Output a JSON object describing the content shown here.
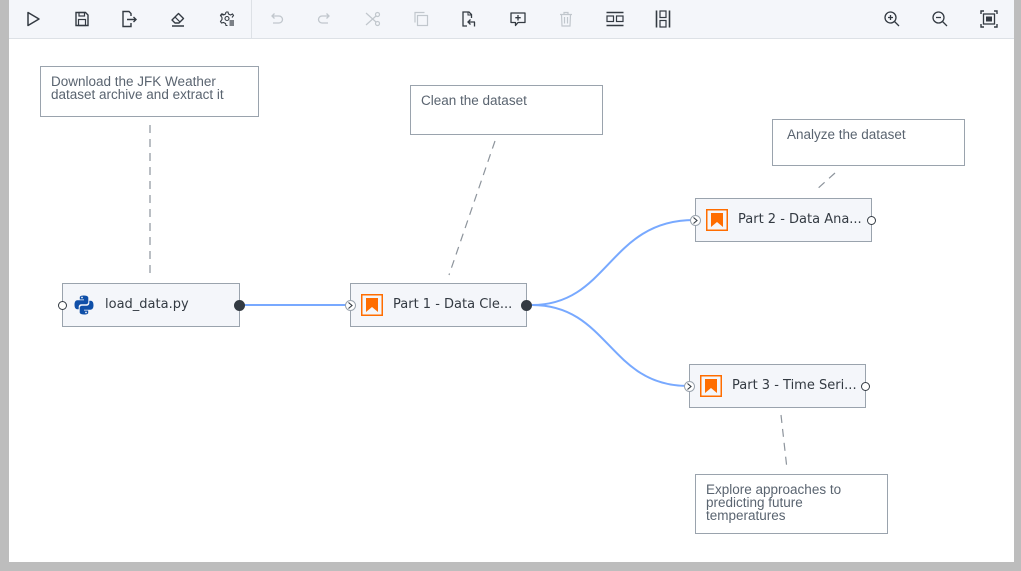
{
  "toolbar": {
    "buttons": [
      {
        "id": "run",
        "icon": "play-icon",
        "enabled": true
      },
      {
        "id": "save",
        "icon": "save-icon",
        "enabled": true
      },
      {
        "id": "export",
        "icon": "export-icon",
        "enabled": true
      },
      {
        "id": "clear",
        "icon": "eraser-icon",
        "enabled": true
      },
      {
        "id": "runtime-settings",
        "icon": "gear-list-icon",
        "enabled": true
      },
      {
        "id": "undo",
        "icon": "undo-icon",
        "enabled": false
      },
      {
        "id": "redo",
        "icon": "redo-icon",
        "enabled": false
      },
      {
        "id": "cut",
        "icon": "scissors-icon",
        "enabled": false
      },
      {
        "id": "copy",
        "icon": "copy-icon",
        "enabled": false
      },
      {
        "id": "paste",
        "icon": "paste-icon",
        "enabled": true
      },
      {
        "id": "add-comment",
        "icon": "add-comment-icon",
        "enabled": true
      },
      {
        "id": "delete",
        "icon": "trash-icon",
        "enabled": false
      },
      {
        "id": "arrange-horizontal",
        "icon": "arrange-horizontal-icon",
        "enabled": true
      },
      {
        "id": "arrange-vertical",
        "icon": "arrange-vertical-icon",
        "enabled": true
      },
      {
        "id": "zoom-in",
        "icon": "zoom-in-icon",
        "enabled": true
      },
      {
        "id": "zoom-out",
        "icon": "zoom-out-icon",
        "enabled": true
      },
      {
        "id": "zoom-to-fit",
        "icon": "fit-screen-icon",
        "enabled": true
      }
    ]
  },
  "comments": [
    {
      "id": "c1",
      "text": "Download the JFK Weather dataset archive and extract it"
    },
    {
      "id": "c2",
      "text": "Clean the dataset"
    },
    {
      "id": "c3",
      "text": "Analyze the dataset"
    },
    {
      "id": "c4",
      "text": "Explore approaches to predicting future temperatures"
    }
  ],
  "nodes": [
    {
      "id": "n1",
      "label": "load_data.py",
      "type": "python"
    },
    {
      "id": "n2",
      "label": "Part 1 - Data Cle...",
      "type": "notebook"
    },
    {
      "id": "n3",
      "label": "Part 2 - Data Ana...",
      "type": "notebook"
    },
    {
      "id": "n4",
      "label": "Part 3 - Time Seri...",
      "type": "notebook"
    }
  ],
  "links": [
    {
      "from": "n1",
      "to": "n2"
    },
    {
      "from": "n2",
      "to": "n3"
    },
    {
      "from": "n2",
      "to": "n4"
    }
  ],
  "colors": {
    "link": "#78a9ff",
    "notebook_icon": "#ff6d00",
    "python_icon": "#0f4fa8",
    "toolbar_icon": "#333a42",
    "toolbar_icon_disabled": "#c1c7cd"
  }
}
